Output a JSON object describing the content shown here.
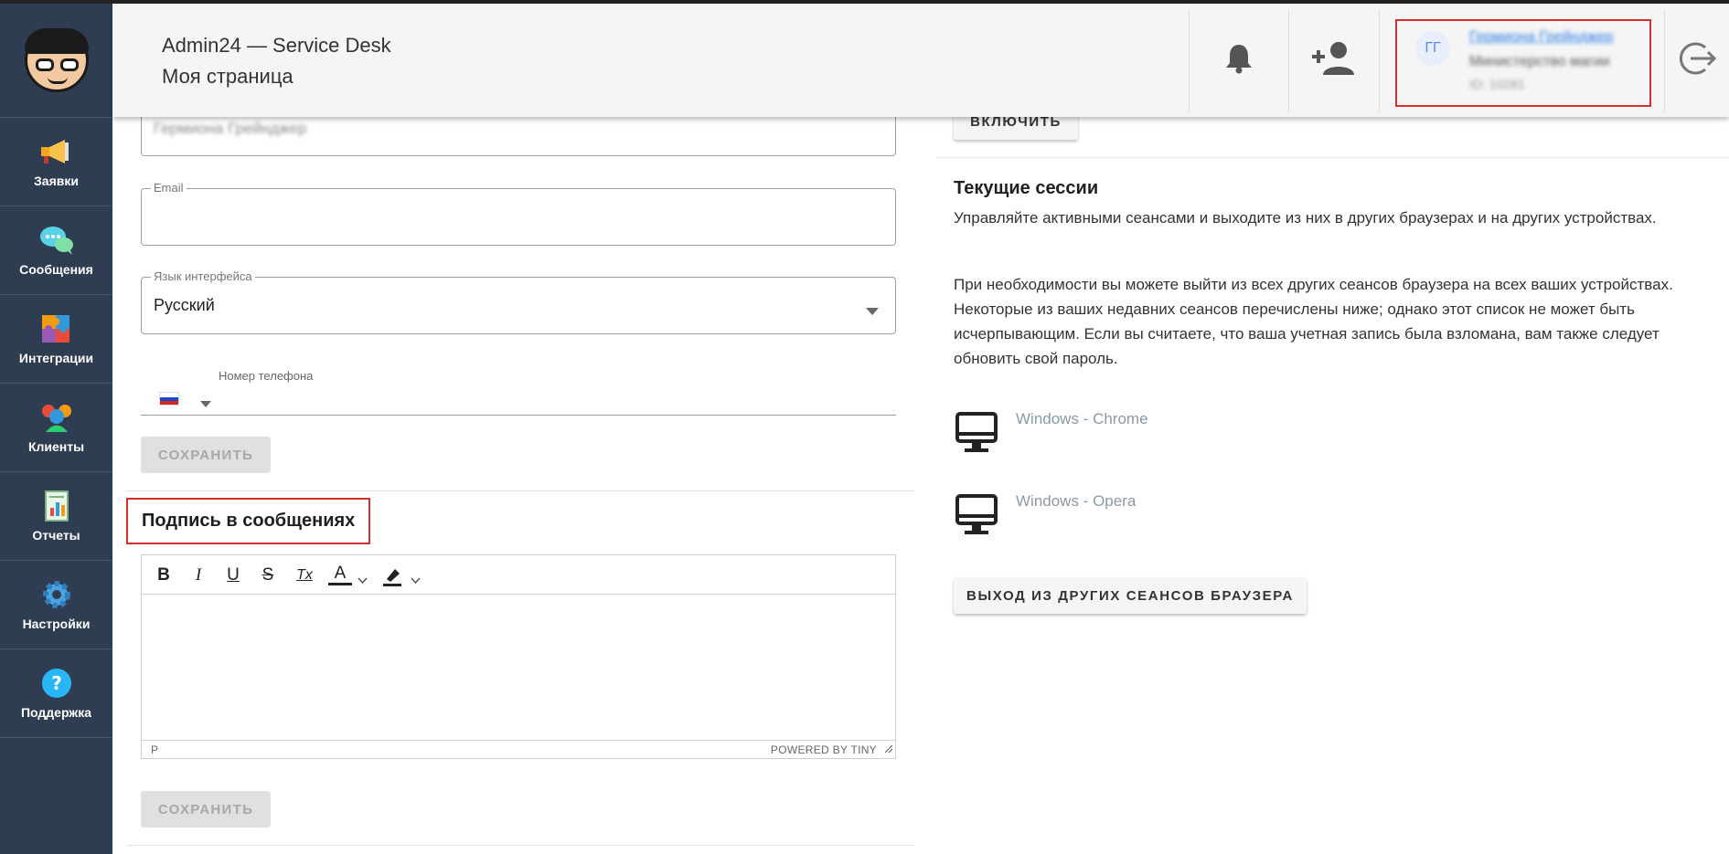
{
  "sidebar": {
    "items": [
      {
        "label": "Заявки",
        "icon": "megaphone-icon"
      },
      {
        "label": "Сообщения",
        "icon": "chat-bubbles-icon"
      },
      {
        "label": "Интеграции",
        "icon": "puzzle-icon"
      },
      {
        "label": "Клиенты",
        "icon": "users-icon"
      },
      {
        "label": "Отчеты",
        "icon": "report-icon"
      },
      {
        "label": "Настройки",
        "icon": "gear-icon"
      },
      {
        "label": "Поддержка",
        "icon": "help-icon"
      }
    ]
  },
  "header": {
    "app_title": "Admin24 — Service Desk",
    "page_title": "Моя страница",
    "user": {
      "initials": "ГГ",
      "name": "Гермиона Грейнджер",
      "organization": "Министерство магии",
      "id": "ID: 10281"
    }
  },
  "profile": {
    "name_value": "Гермиона Грейнджер",
    "email_label": "Email",
    "email_value": "",
    "language_label": "Язык интерфейса",
    "language_value": "Русский",
    "phone_label": "Номер телефона",
    "phone_country": "RU",
    "save_label": "СОХРАНИТЬ"
  },
  "signature": {
    "title": "Подпись в сообщениях",
    "toolbar": [
      "B",
      "I",
      "U",
      "S",
      "Tx",
      "A"
    ],
    "status_path": "P",
    "powered_by": "POWERED BY TINY",
    "save_label": "СОХРАНИТЬ"
  },
  "two_factor": {
    "enable_label": "ВКЛЮЧИТЬ"
  },
  "sessions": {
    "title": "Текущие сессии",
    "description": "Управляйте активными сеансами и выходите из них в других браузерах и на других устройствах.",
    "note": "При необходимости вы можете выйти из всех других сеансов браузера на всех ваших устройствах. Некоторые из ваших недавних сеансов перечислены ниже; однако этот список не может быть исчерпывающим. Если вы считаете, что ваша учетная запись была взломана, вам также следует обновить свой пароль.",
    "items": [
      {
        "name": "Windows - Chrome"
      },
      {
        "name": "Windows - Opera"
      }
    ],
    "logout_label": "ВЫХОД ИЗ ДРУГИХ СЕАНСОВ БРАУЗЕРА"
  },
  "colors": {
    "sidebar_bg": "#2f3d52",
    "highlight_border": "#d32f2f",
    "link": "#2b7de9"
  }
}
